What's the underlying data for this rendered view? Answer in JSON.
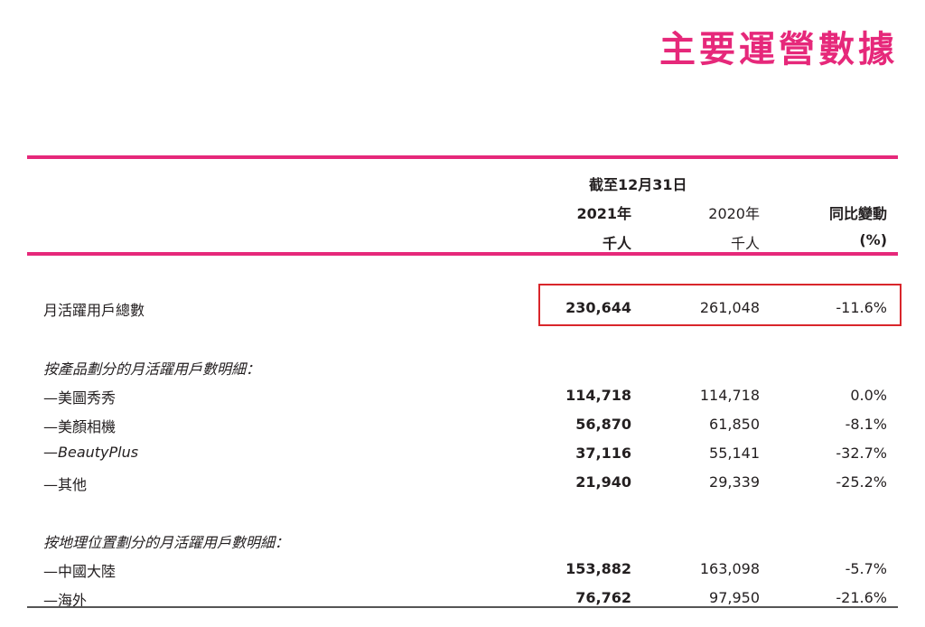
{
  "title": "主要運營數據",
  "header": {
    "period": "截至12月31日",
    "col_2021": "2021年",
    "col_2020": "2020年",
    "col_change": "同比變動",
    "unit_2021": "千人",
    "unit_2020": "千人",
    "unit_change": "(%)"
  },
  "mau_total": {
    "label": "月活躍用戶總數",
    "v2021": "230,644",
    "v2020": "261,048",
    "change": "-11.6%"
  },
  "by_product": {
    "heading": "按產品劃分的月活躍用戶數明細：",
    "rows": [
      {
        "label": "—美圖秀秀",
        "v2021": "114,718",
        "v2020": "114,718",
        "change": "0.0%"
      },
      {
        "label": "—美顏相機",
        "v2021": "56,870",
        "v2020": "61,850",
        "change": "-8.1%"
      },
      {
        "label": "—BeautyPlus",
        "v2021": "37,116",
        "v2020": "55,141",
        "change": "-32.7%"
      },
      {
        "label": "—其他",
        "v2021": "21,940",
        "v2020": "29,339",
        "change": "-25.2%"
      }
    ]
  },
  "by_region": {
    "heading": "按地理位置劃分的月活躍用戶數明細：",
    "rows": [
      {
        "label": "—中國大陸",
        "v2021": "153,882",
        "v2020": "163,098",
        "change": "-5.7%"
      },
      {
        "label": "—海外",
        "v2021": "76,762",
        "v2020": "97,950",
        "change": "-21.6%"
      }
    ]
  },
  "colors": {
    "accent": "#e6287a",
    "highlight_border": "#d9262b"
  }
}
